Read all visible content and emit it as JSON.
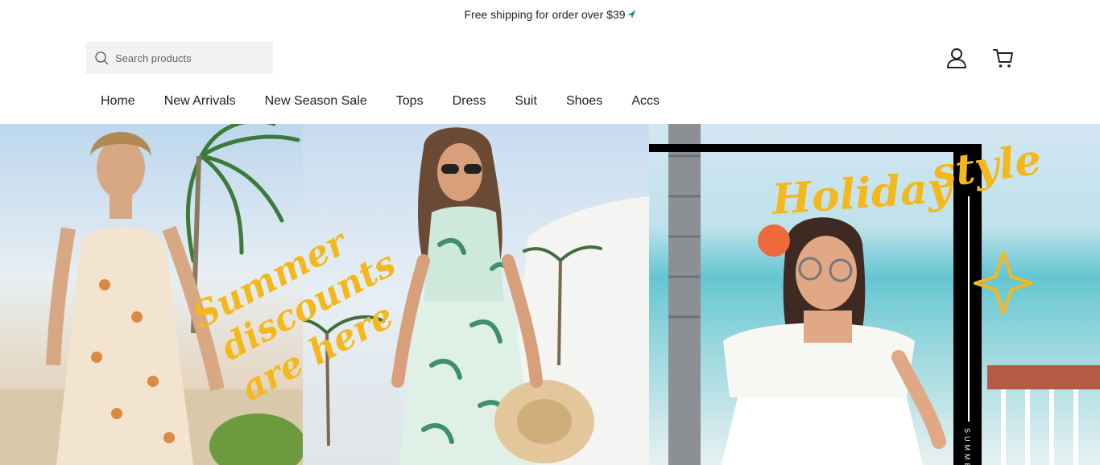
{
  "announcement": {
    "text": "Free shipping for order over $39"
  },
  "search": {
    "placeholder": "Search products"
  },
  "nav": [
    "Home",
    "New Arrivals",
    "New Season Sale",
    "Tops",
    "Dress",
    "Suit",
    "Shoes",
    "Accs"
  ],
  "hero": {
    "script_text_1": [
      "Summer",
      "discounts",
      "are here"
    ],
    "script_text_2": [
      "Holiday",
      "style"
    ],
    "vertical_text": "SUMME",
    "colors": {
      "script": "#f5b81c",
      "frame": "#000000",
      "sea": "#5cc3cf"
    }
  },
  "icons": [
    "search-icon",
    "plane-icon",
    "account-icon",
    "cart-icon"
  ]
}
